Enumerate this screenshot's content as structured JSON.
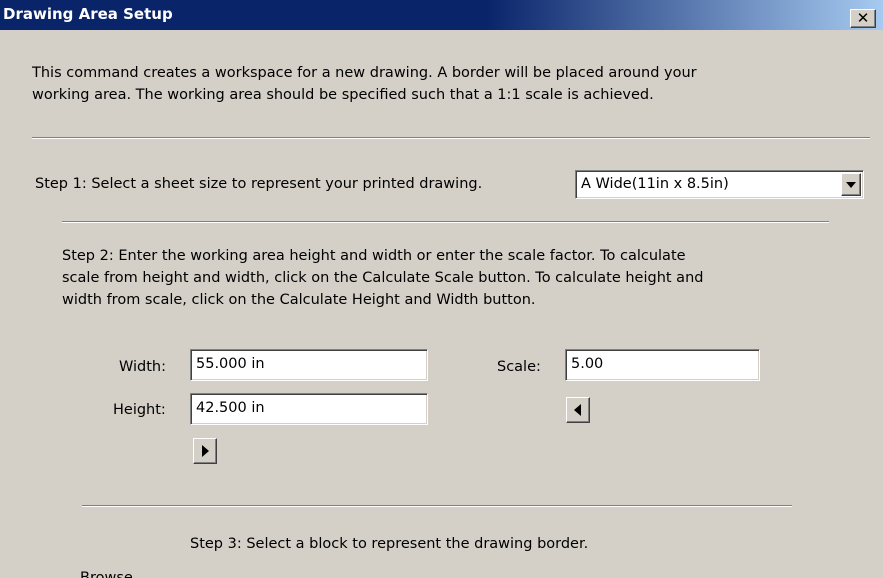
{
  "window": {
    "title": "Drawing Area Setup",
    "close_glyph": "✕"
  },
  "intro": {
    "line1": "This command creates a workspace for a new drawing.  A border will be placed around your",
    "line2": "working area.  The working area should be specified such that a 1:1 scale is achieved."
  },
  "step1": {
    "label": "Step 1: Select a sheet size to represent your printed drawing.",
    "sheet_size_selected": "A Wide(11in x 8.5in)"
  },
  "step2": {
    "line1": "Step 2: Enter the working area height and width or enter the scale factor.  To calculate",
    "line2": "scale from height and width, click on the Calculate Scale button.  To calculate height and",
    "line3": "width from scale, click on the Calculate Height and Width button.",
    "width_label": "Width:",
    "width_value": "55.000 in",
    "height_label": "Height:",
    "height_value": "42.500 in",
    "scale_label": "Scale:",
    "scale_value": "5.00"
  },
  "step3": {
    "label": "Step 3: Select a block to represent the drawing border.",
    "partial_label": "Browse ..."
  },
  "icons": {
    "calculate_height_width": "arrow-left-icon",
    "calculate_scale": "arrow-right-icon",
    "dropdown": "chevron-down-icon",
    "close": "close-icon"
  },
  "colors": {
    "dialog_bg": "#d4d0c8",
    "titlebar_start": "#0a246a",
    "titlebar_end": "#a6caf0",
    "title_text": "#ffffff",
    "field_bg": "#ffffff"
  }
}
